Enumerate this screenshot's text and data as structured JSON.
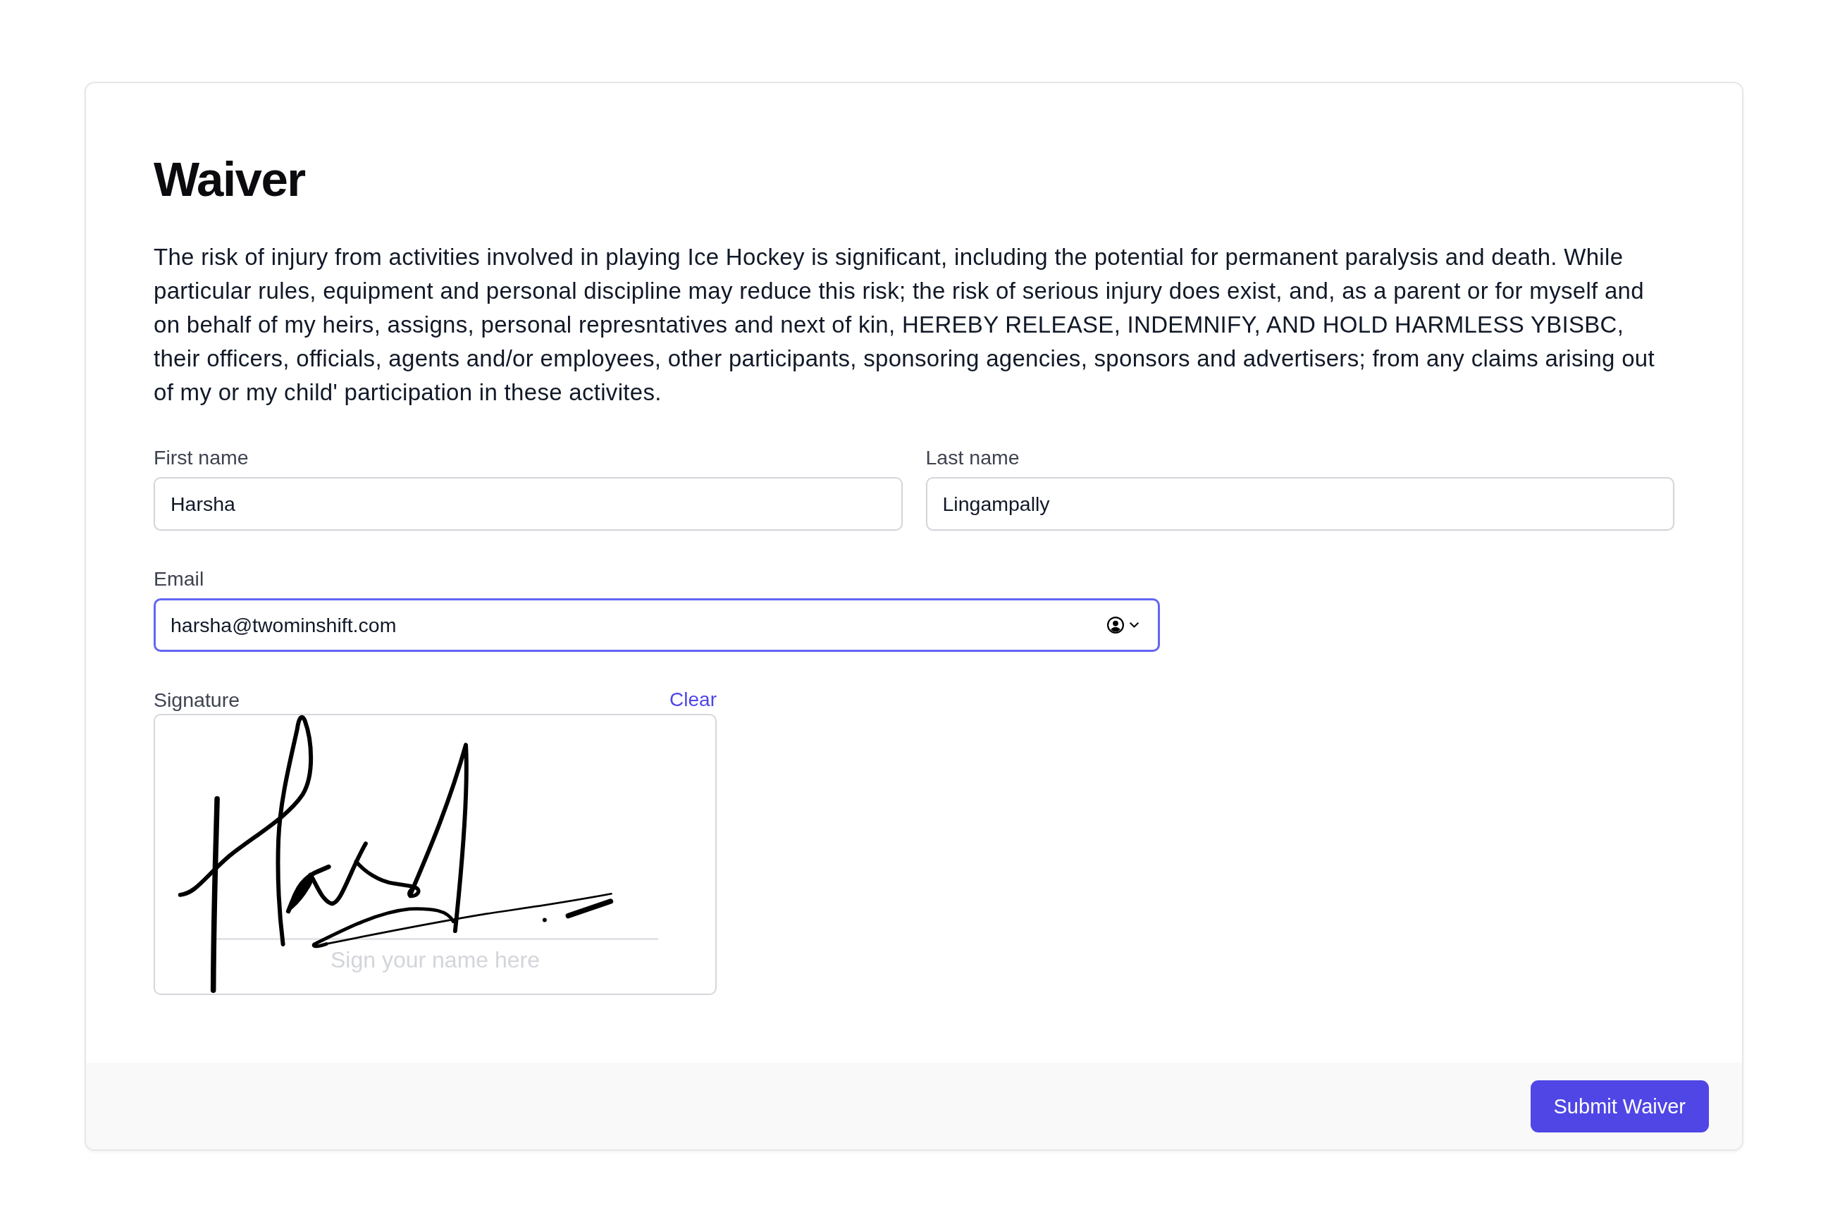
{
  "title": "Waiver",
  "description": "The risk of injury from activities involved in playing Ice Hockey is significant, including the potential for permanent paralysis and death. While particular rules, equipment and personal discipline may reduce this risk; the risk of serious injury does exist, and, as a parent or for myself and on behalf of my heirs, assigns, personal represntatives and next of kin, HEREBY RELEASE, INDEMNIFY, AND HOLD HARMLESS YBISBC, their officers, officials, agents and/or employees, other participants, sponsoring agencies, sponsors and advertisers; from any claims arising out of my or my child' participation in these activites.",
  "fields": [
    {
      "kind": "text",
      "label": "First name",
      "value": "Harsha",
      "focused": false
    },
    {
      "kind": "text",
      "label": "Last name",
      "value": "Lingampally",
      "focused": false
    },
    {
      "kind": "email",
      "label": "Email",
      "value": "harsha@twominshift.com",
      "focused": true
    }
  ],
  "signature": {
    "label": "Signature",
    "clear_link": "Clear",
    "placeholder": "Sign your name here",
    "signed": true
  },
  "footer": {
    "submit_button": "Submit Waiver"
  }
}
